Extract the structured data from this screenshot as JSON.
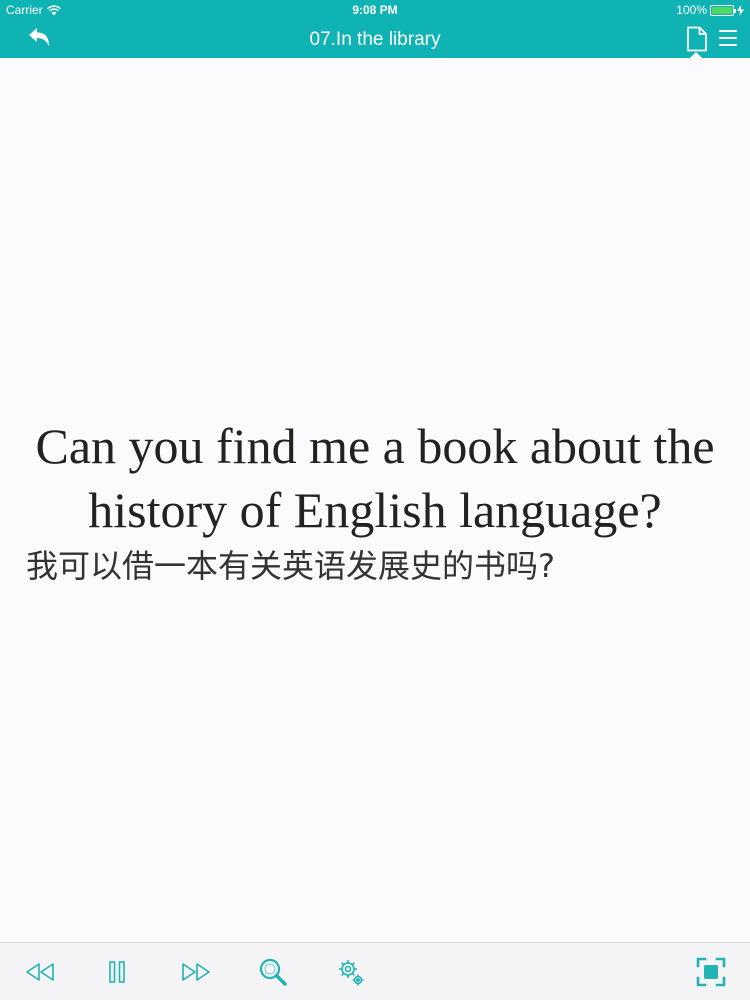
{
  "status_bar": {
    "carrier": "Carrier",
    "time": "9:08 PM",
    "battery": "100%",
    "battery_color": "#4cd964"
  },
  "nav": {
    "title": "07.In the library",
    "bar_color": "#10b3b3",
    "icons": [
      "back-arrow-icon",
      "document-icon",
      "menu-icon"
    ]
  },
  "content": {
    "sentence_en": "Can you find me a book about the history of English language?",
    "sentence_zh": "我可以借一本有关英语发展史的书吗?"
  },
  "toolbar": {
    "accent_color": "#22b3b3",
    "icons": [
      "rewind-icon",
      "pause-icon",
      "fast-forward-icon",
      "search-icon",
      "settings-icon",
      "fullscreen-icon"
    ]
  }
}
